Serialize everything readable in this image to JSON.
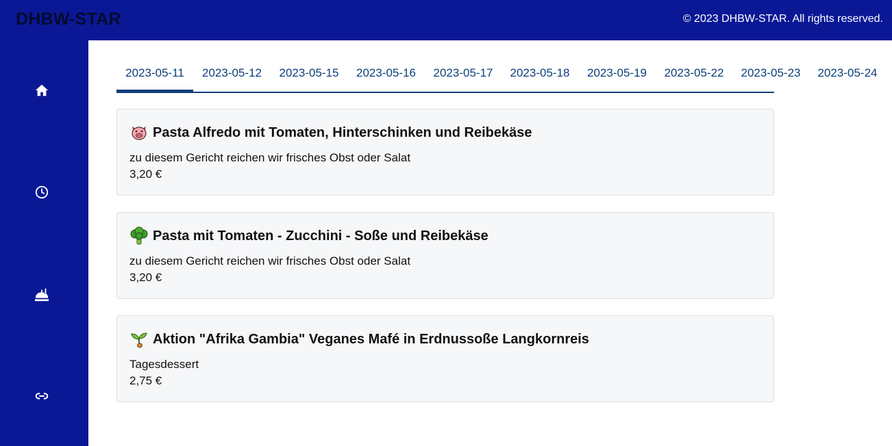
{
  "header": {
    "brand": "DHBW-STAR",
    "copyright": "© 2023 DHBW-STAR. All rights reserved."
  },
  "sidebar": {
    "items": [
      {
        "icon": "home-icon"
      },
      {
        "icon": "clock-icon"
      },
      {
        "icon": "food-service-icon"
      },
      {
        "icon": "link-icon"
      }
    ]
  },
  "tabs": [
    {
      "label": "2023-05-11",
      "active": true
    },
    {
      "label": "2023-05-12"
    },
    {
      "label": "2023-05-15"
    },
    {
      "label": "2023-05-16"
    },
    {
      "label": "2023-05-17"
    },
    {
      "label": "2023-05-18"
    },
    {
      "label": "2023-05-19"
    },
    {
      "label": "2023-05-22"
    },
    {
      "label": "2023-05-23"
    },
    {
      "label": "2023-05-24"
    }
  ],
  "meals": [
    {
      "icon": "pig-icon",
      "title": "Pasta Alfredo mit Tomaten, Hinterschinken und Reibekäse",
      "description": "zu diesem Gericht reichen wir frisches Obst oder Salat",
      "price": "3,20 €"
    },
    {
      "icon": "broccoli-icon",
      "title": "Pasta mit Tomaten - Zucchini - Soße und Reibekäse",
      "description": "zu diesem Gericht reichen wir frisches Obst oder Salat",
      "price": "3,20 €"
    },
    {
      "icon": "seedling-icon",
      "title": "Aktion \"Afrika Gambia\" Veganes Mafé in Erdnussoße Langkornreis",
      "description": "Tagesdessert",
      "price": "2,75 €"
    }
  ],
  "colors": {
    "brand_blue": "#0a1896",
    "tab_blue": "#0d3f7a",
    "card_bg": "#f6f7f9"
  }
}
